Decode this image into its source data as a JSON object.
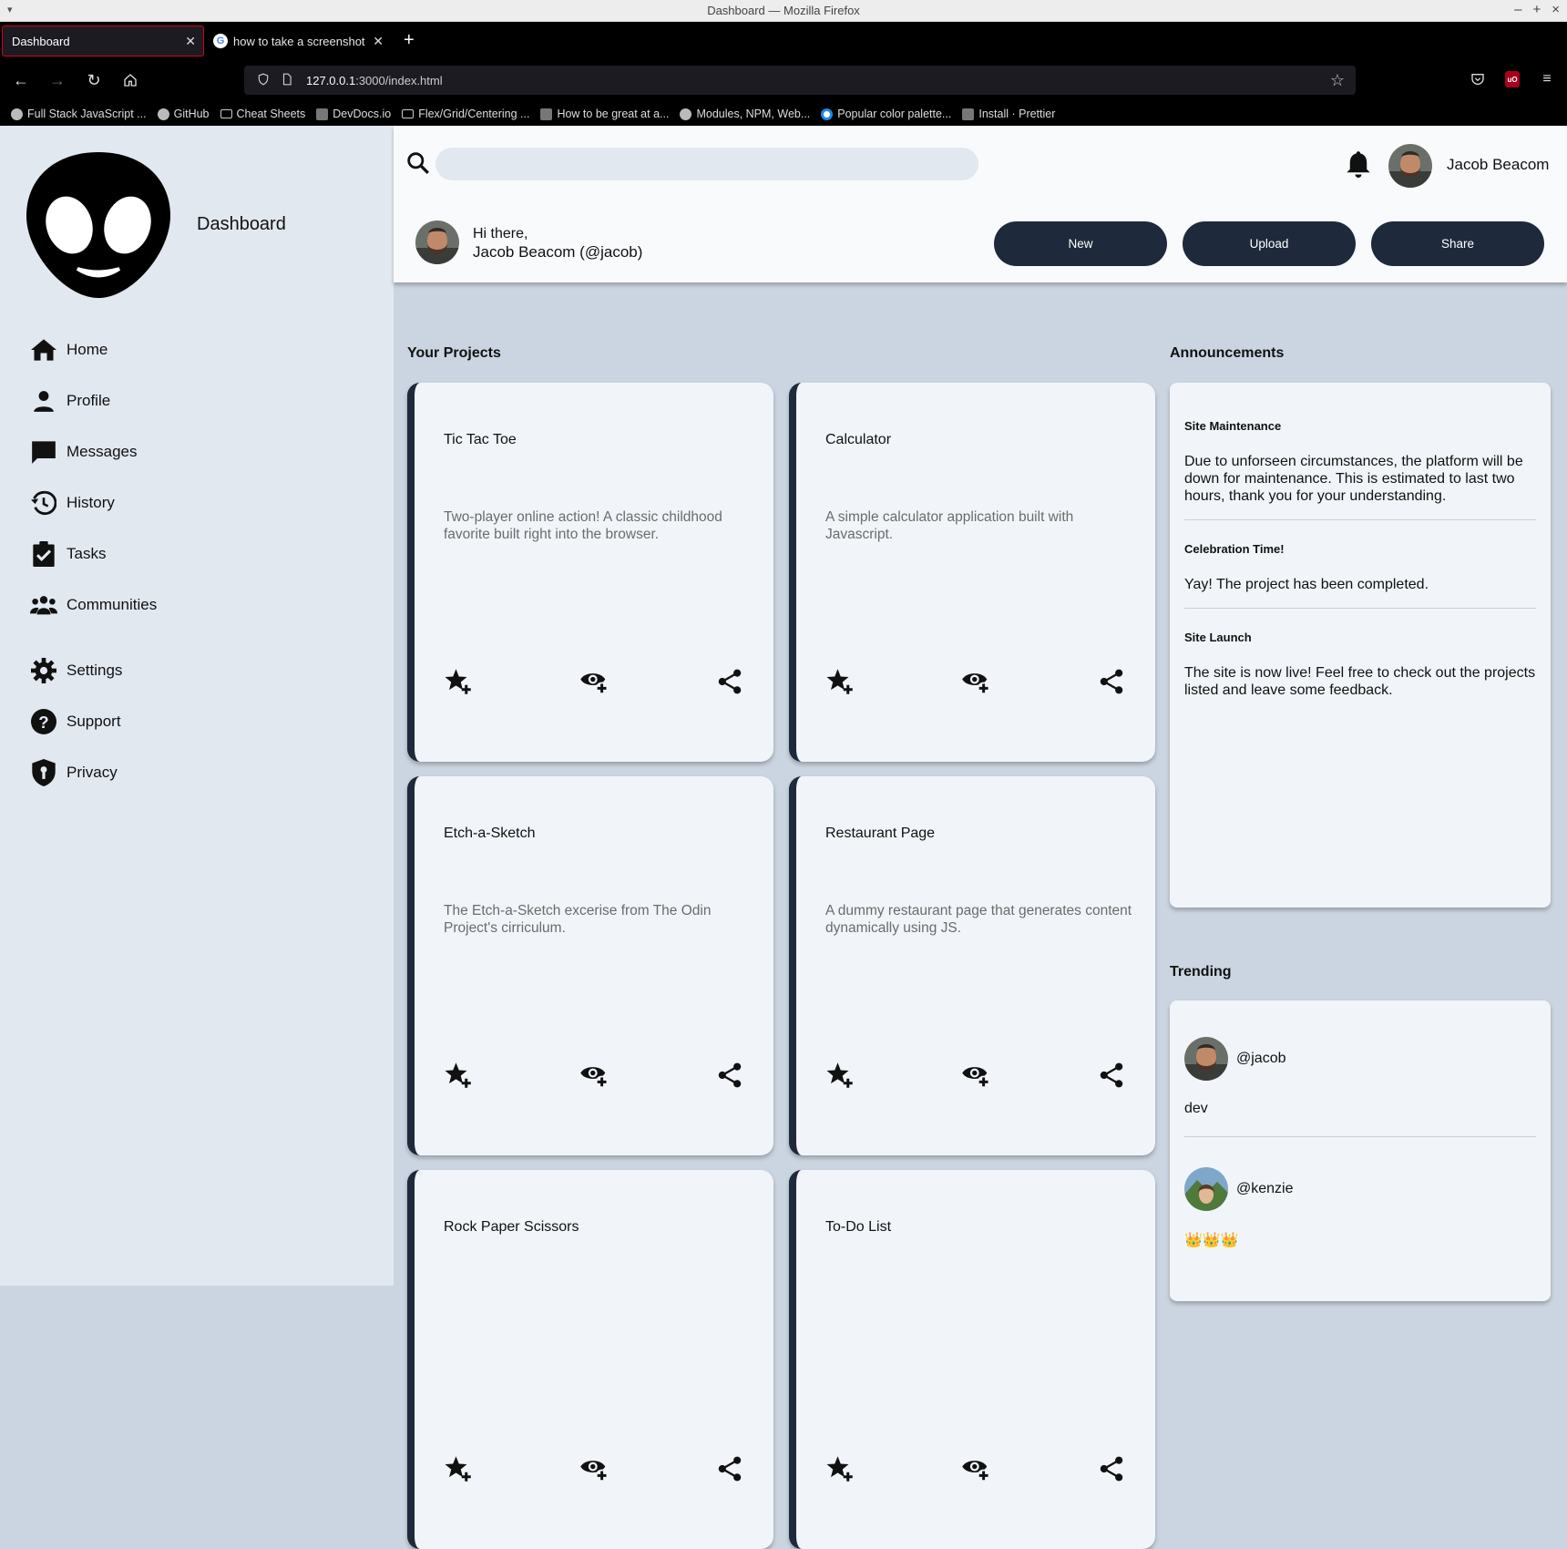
{
  "window": {
    "title": "Dashboard — Mozilla Firefox"
  },
  "tabs": [
    {
      "label": "Dashboard",
      "active": true
    },
    {
      "label": "how to take a screenshot xubu",
      "active": false
    }
  ],
  "urlbar": {
    "host": "127.0.0.1",
    "rest": ":3000/index.html"
  },
  "bookmarks": [
    {
      "label": "Full Stack JavaScript ...",
      "icon": "odin-icon"
    },
    {
      "label": "GitHub",
      "icon": "github-icon"
    },
    {
      "label": "Cheat Sheets",
      "icon": "folder-icon"
    },
    {
      "label": "DevDocs.io",
      "icon": "devdocs-icon"
    },
    {
      "label": "Flex/Grid/Centering ...",
      "icon": "folder-icon"
    },
    {
      "label": "How to be great at a...",
      "icon": "medium-icon"
    },
    {
      "label": "Modules, NPM, Web...",
      "icon": "odin-icon"
    },
    {
      "label": "Popular color palette...",
      "icon": "palette-icon"
    },
    {
      "label": "Install · Prettier",
      "icon": "prettier-icon"
    }
  ],
  "sidebar": {
    "brand": "Dashboard",
    "main_items": [
      {
        "label": "Home",
        "icon": "home-icon"
      },
      {
        "label": "Profile",
        "icon": "person-icon"
      },
      {
        "label": "Messages",
        "icon": "message-icon"
      },
      {
        "label": "History",
        "icon": "history-icon"
      },
      {
        "label": "Tasks",
        "icon": "clipboard-check-icon"
      },
      {
        "label": "Communities",
        "icon": "groups-icon"
      }
    ],
    "secondary_items": [
      {
        "label": "Settings",
        "icon": "gear-icon"
      },
      {
        "label": "Support",
        "icon": "help-icon"
      },
      {
        "label": "Privacy",
        "icon": "shield-icon"
      }
    ]
  },
  "header": {
    "search": {
      "value": "",
      "placeholder": ""
    },
    "user_name": "Jacob Beacom",
    "greeting": "Hi there,",
    "greeting_name": "Jacob Beacom (@jacob)",
    "buttons": {
      "new": "New",
      "upload": "Upload",
      "share": "Share"
    }
  },
  "projects": {
    "title": "Your Projects",
    "items": [
      {
        "title": "Tic Tac Toe",
        "description": "Two-player online action! A classic childhood favorite built right into the browser."
      },
      {
        "title": "Calculator",
        "description": "A simple calculator application built with Javascript."
      },
      {
        "title": "Etch-a-Sketch",
        "description": "The Etch-a-Sketch excerise from The Odin Project's cirriculum."
      },
      {
        "title": "Restaurant Page",
        "description": "A dummy restaurant page that generates content dynamically using JS."
      },
      {
        "title": "Rock Paper Scissors",
        "description": ""
      },
      {
        "title": "To-Do List",
        "description": ""
      }
    ]
  },
  "announcements": {
    "title": "Announcements",
    "items": [
      {
        "title": "Site Maintenance",
        "body": "Due to unforseen circumstances, the platform will be down for maintenance. This is estimated to last two hours, thank you for your understanding."
      },
      {
        "title": "Celebration Time!",
        "body": "Yay! The project has been completed."
      },
      {
        "title": "Site Launch",
        "body": "The site is now live! Feel free to check out the projects listed and leave some feedback."
      }
    ]
  },
  "trending": {
    "title": "Trending",
    "items": [
      {
        "handle": "@jacob",
        "body": "dev"
      },
      {
        "handle": "@kenzie",
        "body": "👑👑👑"
      }
    ]
  },
  "colors": {
    "sidebar": "#e2e8f0",
    "content": "#cbd5e1",
    "header": "#f8fafc",
    "card": "#f1f5f9",
    "accent": "#1e293b"
  }
}
